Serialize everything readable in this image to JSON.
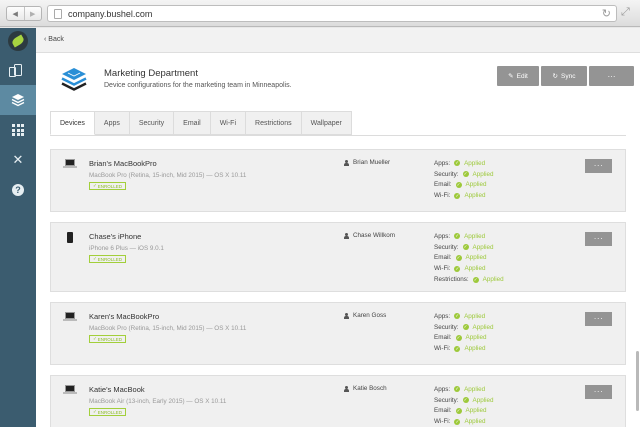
{
  "browser": {
    "url": "company.bushel.com"
  },
  "sidebar": {
    "items": [
      {
        "icon": "device-tablet-icon"
      },
      {
        "icon": "layers-icon",
        "active": true
      },
      {
        "icon": "apps-grid-icon"
      },
      {
        "icon": "tools-icon"
      },
      {
        "icon": "help-icon",
        "glyph": "?"
      }
    ]
  },
  "nav": {
    "back_label": "Back"
  },
  "department": {
    "title": "Marketing Department",
    "description": "Device configurations for the marketing team in Minneapolis."
  },
  "actions": {
    "edit_label": "Edit",
    "sync_label": "Sync",
    "more_label": "···"
  },
  "tabs": [
    "Devices",
    "Apps",
    "Security",
    "Email",
    "Wi-Fi",
    "Restrictions",
    "Wallpaper"
  ],
  "devices": [
    {
      "name": "Brian's MacBookPro",
      "model": "MacBook Pro (Retina, 15-inch, Mid 2015) — OS X 10.11",
      "badge": "ENROLLED",
      "owner": "Brian Mueller",
      "type": "laptop",
      "statuses": [
        {
          "label": "Apps:",
          "value": "Applied"
        },
        {
          "label": "Security:",
          "value": "Applied"
        },
        {
          "label": "Email:",
          "value": "Applied"
        },
        {
          "label": "Wi-Fi:",
          "value": "Applied"
        }
      ]
    },
    {
      "name": "Chase's iPhone",
      "model": "iPhone 6 Plus — iOS 9.0.1",
      "badge": "ENROLLED",
      "owner": "Chase Willkom",
      "type": "phone",
      "statuses": [
        {
          "label": "Apps:",
          "value": "Applied"
        },
        {
          "label": "Security:",
          "value": "Applied"
        },
        {
          "label": "Email:",
          "value": "Applied"
        },
        {
          "label": "Wi-Fi:",
          "value": "Applied"
        },
        {
          "label": "Restrictions:",
          "value": "Applied"
        }
      ]
    },
    {
      "name": "Karen's MacBookPro",
      "model": "MacBook Pro (Retina, 15-inch, Mid 2015) — OS X 10.11",
      "badge": "ENROLLED",
      "owner": "Karen Goss",
      "type": "laptop",
      "statuses": [
        {
          "label": "Apps:",
          "value": "Applied"
        },
        {
          "label": "Security:",
          "value": "Applied"
        },
        {
          "label": "Email:",
          "value": "Applied"
        },
        {
          "label": "Wi-Fi:",
          "value": "Applied"
        }
      ]
    },
    {
      "name": "Katie's MacBook",
      "model": "MacBook Air (13-inch, Early 2015) — OS X 10.11",
      "badge": "ENROLLED",
      "owner": "Katie Bosch",
      "type": "laptop",
      "statuses": [
        {
          "label": "Apps:",
          "value": "Applied"
        },
        {
          "label": "Security:",
          "value": "Applied"
        },
        {
          "label": "Email:",
          "value": "Applied"
        },
        {
          "label": "Wi-Fi:",
          "value": "Applied"
        }
      ]
    }
  ],
  "colors": {
    "sidebar": "#3b5c6f",
    "sidebar_active": "#5d8aa2",
    "applied": "#9dc93a",
    "button": "#949494",
    "brand_icon": "#2a8fd6"
  }
}
